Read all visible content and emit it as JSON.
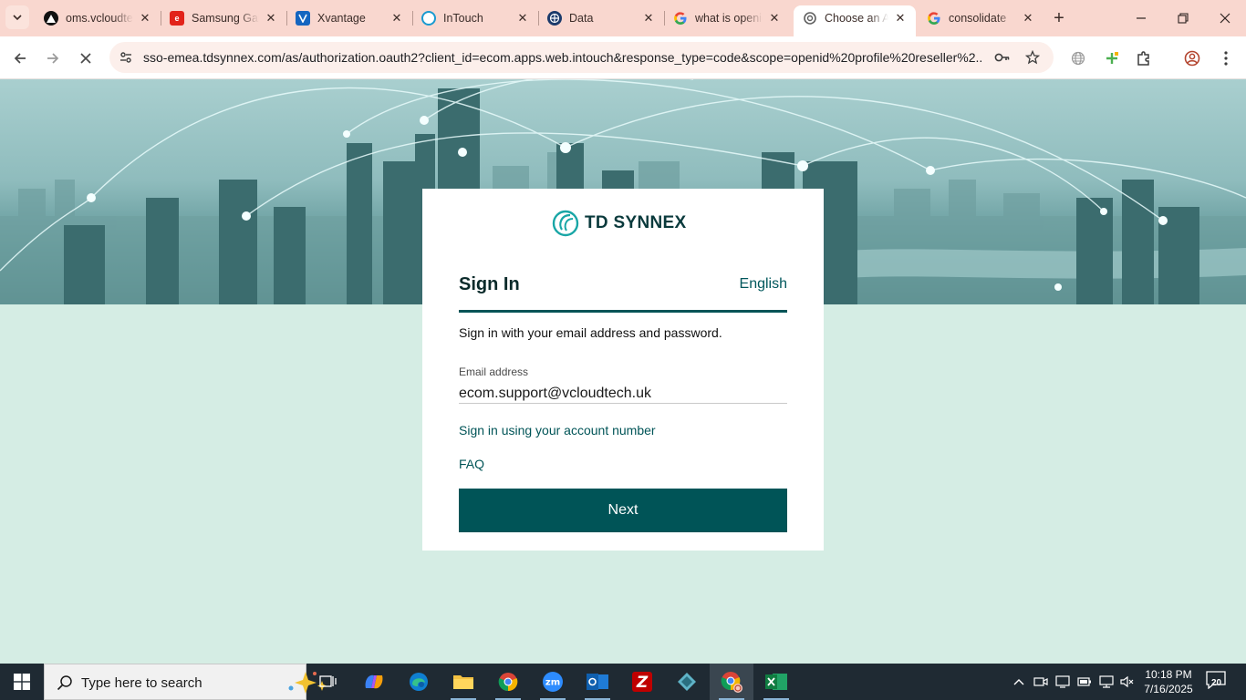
{
  "browser": {
    "tabs": [
      {
        "title": "oms.vcloudtech",
        "favicon": "vercel-icon"
      },
      {
        "title": "Samsung Galaxy",
        "favicon": "samsung-e-icon"
      },
      {
        "title": "Xvantage",
        "favicon": "xvantage-icon"
      },
      {
        "title": "InTouch",
        "favicon": "intouch-icon"
      },
      {
        "title": "Data",
        "favicon": "data-icon"
      },
      {
        "title": "what is openid",
        "favicon": "google-icon"
      },
      {
        "title": "Choose an Account",
        "favicon": "loading-icon",
        "active": true
      },
      {
        "title": "consolidate",
        "favicon": "google-icon"
      }
    ],
    "url": "sso-emea.tdsynnex.com/as/authorization.oauth2?client_id=ecom.apps.web.intouch&response_type=code&scope=openid%20profile%20reseller%2..."
  },
  "page": {
    "logo_text": "TD SYNNEX",
    "title": "Sign In",
    "language": "English",
    "instruction": "Sign in with your email address and password.",
    "email_label": "Email address",
    "email_value": "ecom.support@vcloudtech.uk",
    "account_number_link": "Sign in using your account number",
    "faq_link": "FAQ",
    "next_label": "Next",
    "brand_color": "#005457"
  },
  "taskbar": {
    "search_placeholder": "Type here to search",
    "time": "10:18 PM",
    "date": "7/16/2025",
    "notifications": "20"
  }
}
